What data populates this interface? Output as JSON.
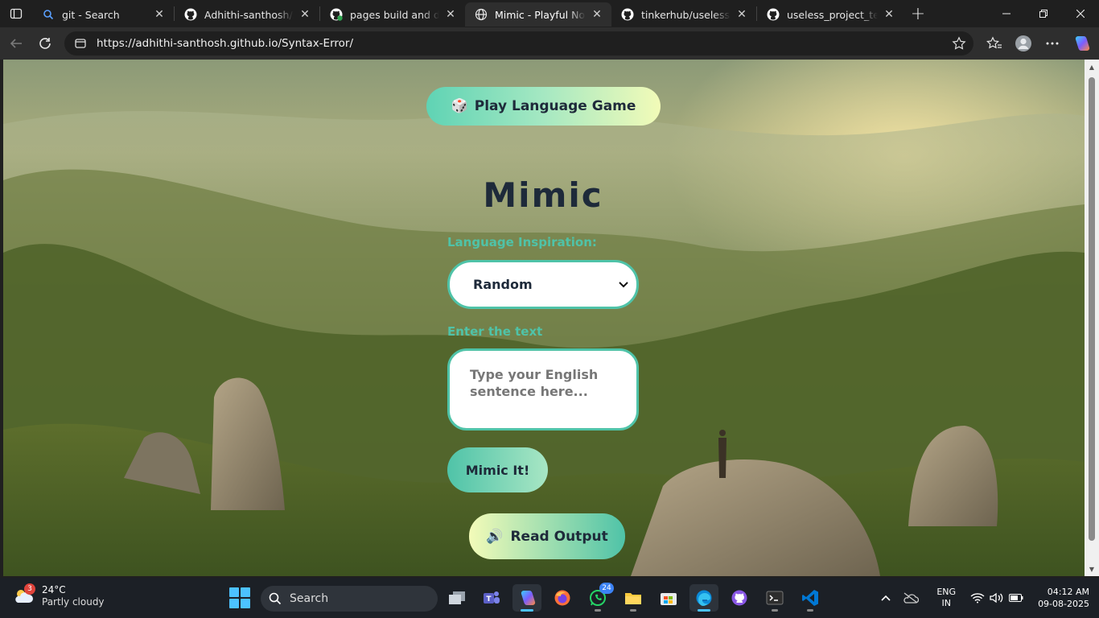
{
  "browser": {
    "tabs": [
      {
        "title": "git - Search",
        "icon": "bing-search-icon",
        "active": false
      },
      {
        "title": "Adhithi-santhosh/Syntax-Error",
        "icon": "github-icon",
        "active": false
      },
      {
        "title": "pages build and deployment",
        "icon": "github-actions-icon",
        "active": false
      },
      {
        "title": "Mimic - Playful Nonsense Generator",
        "icon": "globe-icon",
        "active": true
      },
      {
        "title": "tinkerhub/useless_project",
        "icon": "github-icon",
        "active": false
      },
      {
        "title": "useless_project_temp/README",
        "icon": "github-icon",
        "active": false
      }
    ],
    "new_tab_label": "+",
    "address": {
      "url": "https://adhithi-santhosh.github.io/Syntax-Error/"
    }
  },
  "app": {
    "game_button": {
      "icon": "🎲",
      "label": "Play Language Game"
    },
    "title": "Mimic",
    "language_label": "Language Inspiration:",
    "language_select": {
      "selected": "Random"
    },
    "text_label": "Enter the text",
    "text_input": {
      "placeholder": "Type your English sentence here..."
    },
    "mimic_button": "Mimic It!",
    "read_button": {
      "icon": "🔊",
      "label": "Read Output"
    }
  },
  "taskbar": {
    "weather": {
      "temp": "24°C",
      "condition": "Partly cloudy",
      "badge": "3"
    },
    "search_label": "Search",
    "whatsapp_badge": "24",
    "language": {
      "line1": "ENG",
      "line2": "IN"
    },
    "clock": {
      "time": "04:12 AM",
      "date": "09-08-2025"
    }
  },
  "colors": {
    "accent_teal": "#4fc3a8",
    "title_navy": "#1e2a3a",
    "browser_dark": "#1f1f1f"
  }
}
